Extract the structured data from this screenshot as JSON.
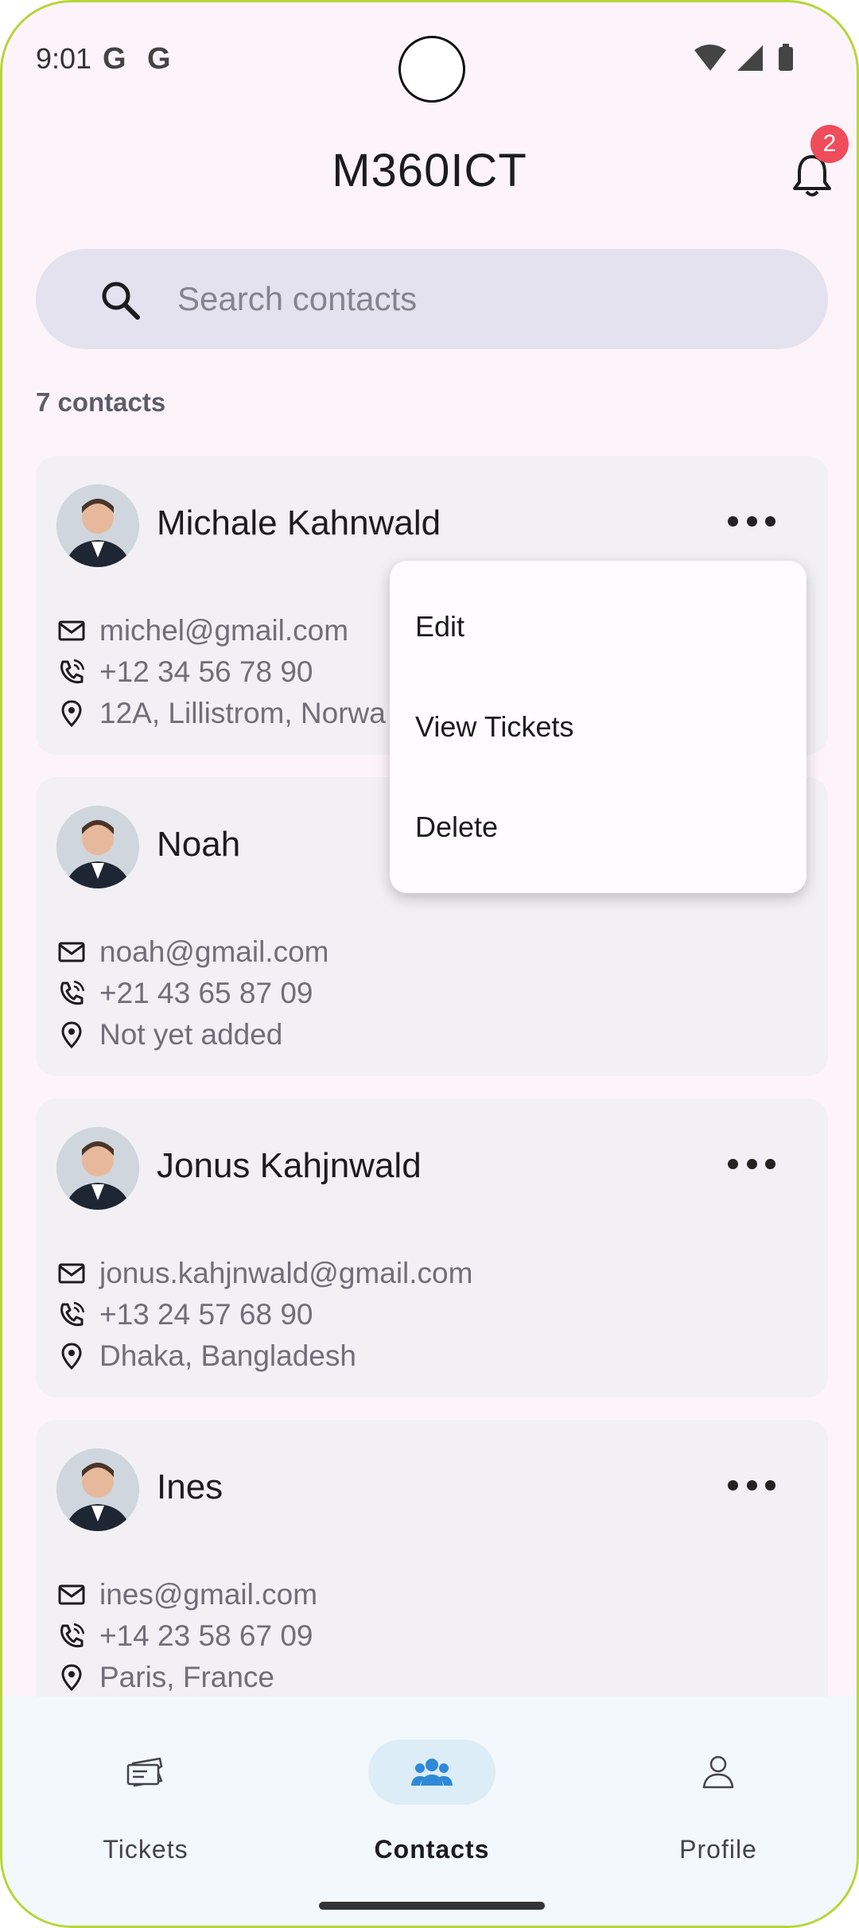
{
  "status_bar": {
    "time": "9:01",
    "g1": "G",
    "g2": "G"
  },
  "header": {
    "title": "M360ICT",
    "notification_count": "2"
  },
  "search": {
    "placeholder": "Search contacts"
  },
  "contacts_count": "7 contacts",
  "contacts": [
    {
      "name": "Michale Kahnwald",
      "email": "michel@gmail.com",
      "phone": "+12 34 56 78 90",
      "address": "12A, Lillistrom, Norwa"
    },
    {
      "name": "Noah",
      "email": "noah@gmail.com",
      "phone": "+21 43 65 87 09",
      "address": "Not yet added"
    },
    {
      "name": "Jonus Kahjnwald",
      "email": "jonus.kahjnwald@gmail.com",
      "phone": "+13 24 57 68 90",
      "address": "Dhaka, Bangladesh"
    },
    {
      "name": "Ines",
      "email": "ines@gmail.com",
      "phone": "+14 23 58 67 09",
      "address": "Paris, France"
    }
  ],
  "menu": {
    "edit": "Edit",
    "view_tickets": "View Tickets",
    "delete": "Delete"
  },
  "nav": {
    "items": [
      {
        "label": "Tickets",
        "icon": "ticket-icon"
      },
      {
        "label": "Contacts",
        "icon": "people-icon",
        "active": true
      },
      {
        "label": "Profile",
        "icon": "person-icon"
      }
    ]
  },
  "colors": {
    "accent": "#2f89d8",
    "badge": "#ef4c5c",
    "background": "#fcf4fa"
  }
}
